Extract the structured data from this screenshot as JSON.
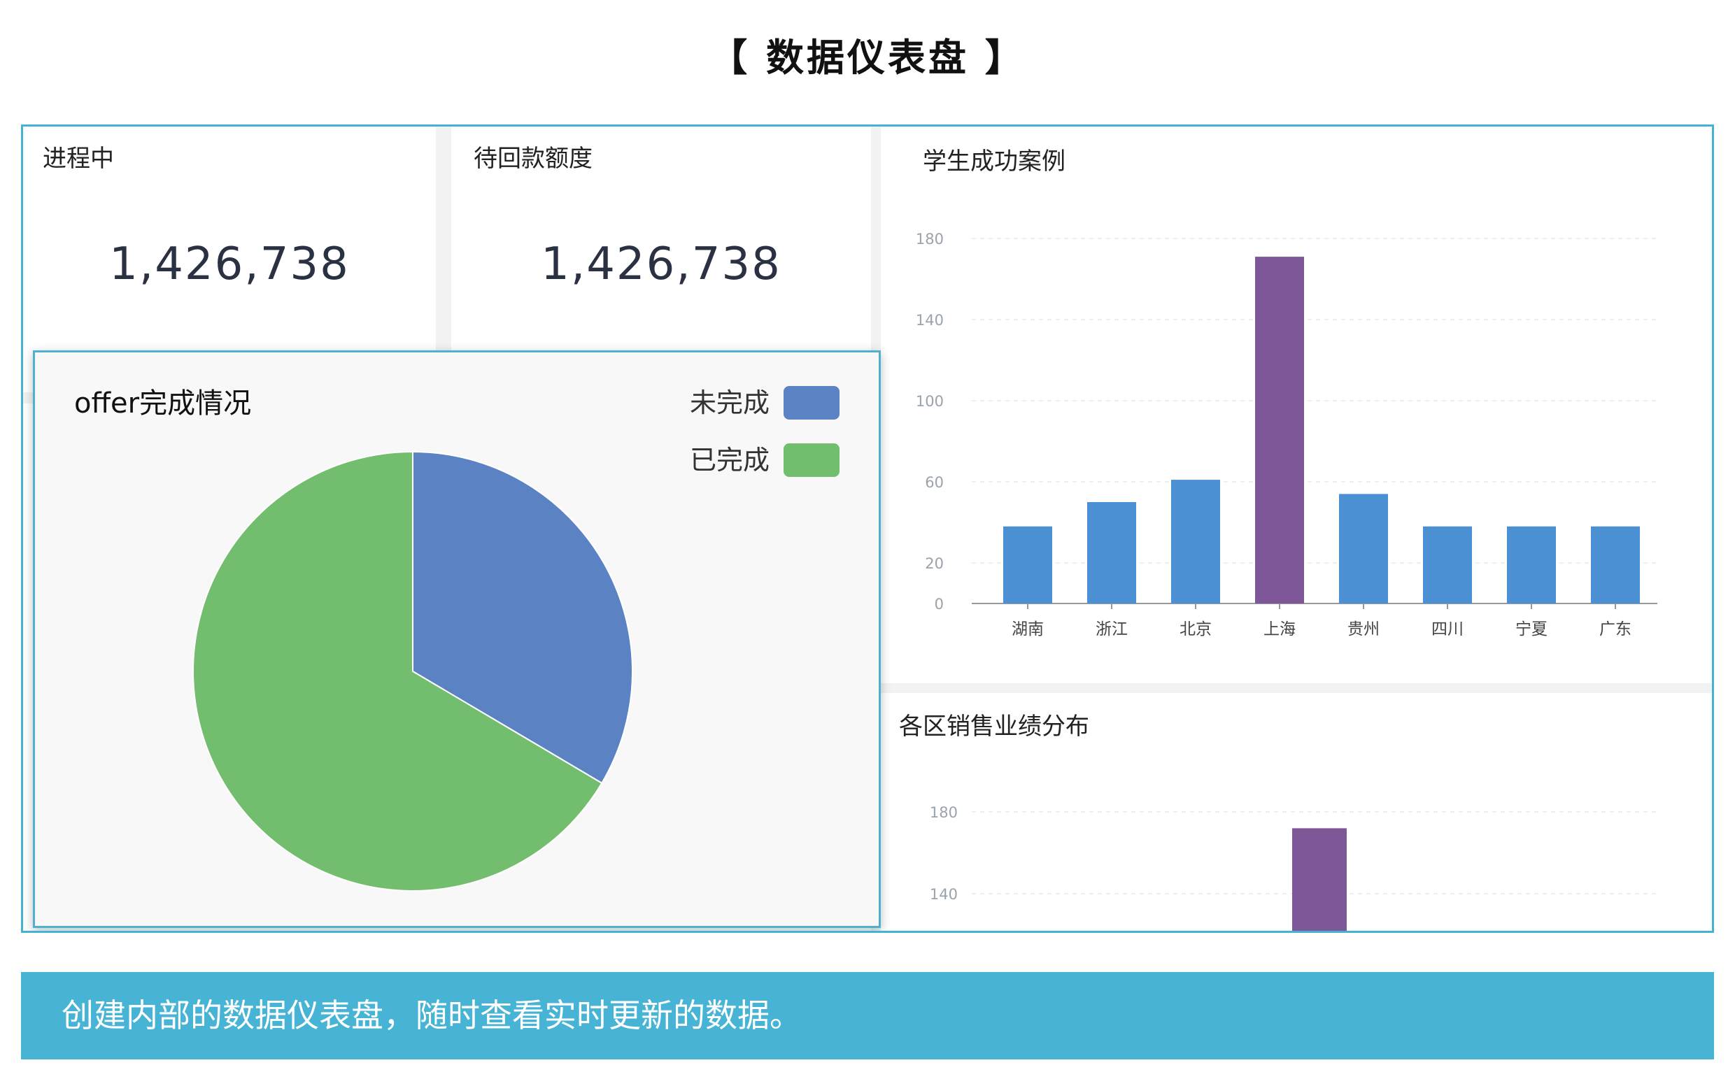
{
  "page": {
    "title": "【 数据仪表盘 】",
    "banner": "创建内部的数据仪表盘，随时查看实时更新的数据。"
  },
  "kpis": [
    {
      "label": "进程中",
      "value": "1,426,738"
    },
    {
      "label": "待回款额度",
      "value": "1,426,738"
    }
  ],
  "colors": {
    "frame": "#46b2d3",
    "bar": "#4a90d2",
    "bar_highlight": "#7e5798",
    "pie_uncompleted": "#5b82c3",
    "pie_completed": "#73be6e",
    "banner": "#47b4d5"
  },
  "pie_card": {
    "title": "offer完成情况",
    "legend": [
      {
        "label": "未完成",
        "color": "#5b82c3"
      },
      {
        "label": "已完成",
        "color": "#73be6e"
      }
    ]
  },
  "cases_card": {
    "title": "学生成功案例"
  },
  "sales_card": {
    "title": "各区销售业绩分布"
  },
  "chart_data": [
    {
      "type": "pie",
      "title": "offer完成情况",
      "categories": [
        "未完成",
        "已完成"
      ],
      "values": [
        33.5,
        66.5
      ]
    },
    {
      "type": "bar",
      "title": "学生成功案例",
      "categories": [
        "湖南",
        "浙江",
        "北京",
        "上海",
        "贵州",
        "四川",
        "宁夏",
        "广东"
      ],
      "values": [
        38,
        50,
        61,
        171,
        54,
        38,
        38,
        38
      ],
      "highlight_index": 3,
      "yticks": [
        0,
        20,
        60,
        100,
        140,
        180
      ],
      "ylim": [
        0,
        180
      ],
      "grid": true
    },
    {
      "type": "bar",
      "title": "各区销售业绩分布",
      "yticks": [
        140,
        180
      ],
      "visible_values": [
        172
      ],
      "grid": true
    }
  ]
}
